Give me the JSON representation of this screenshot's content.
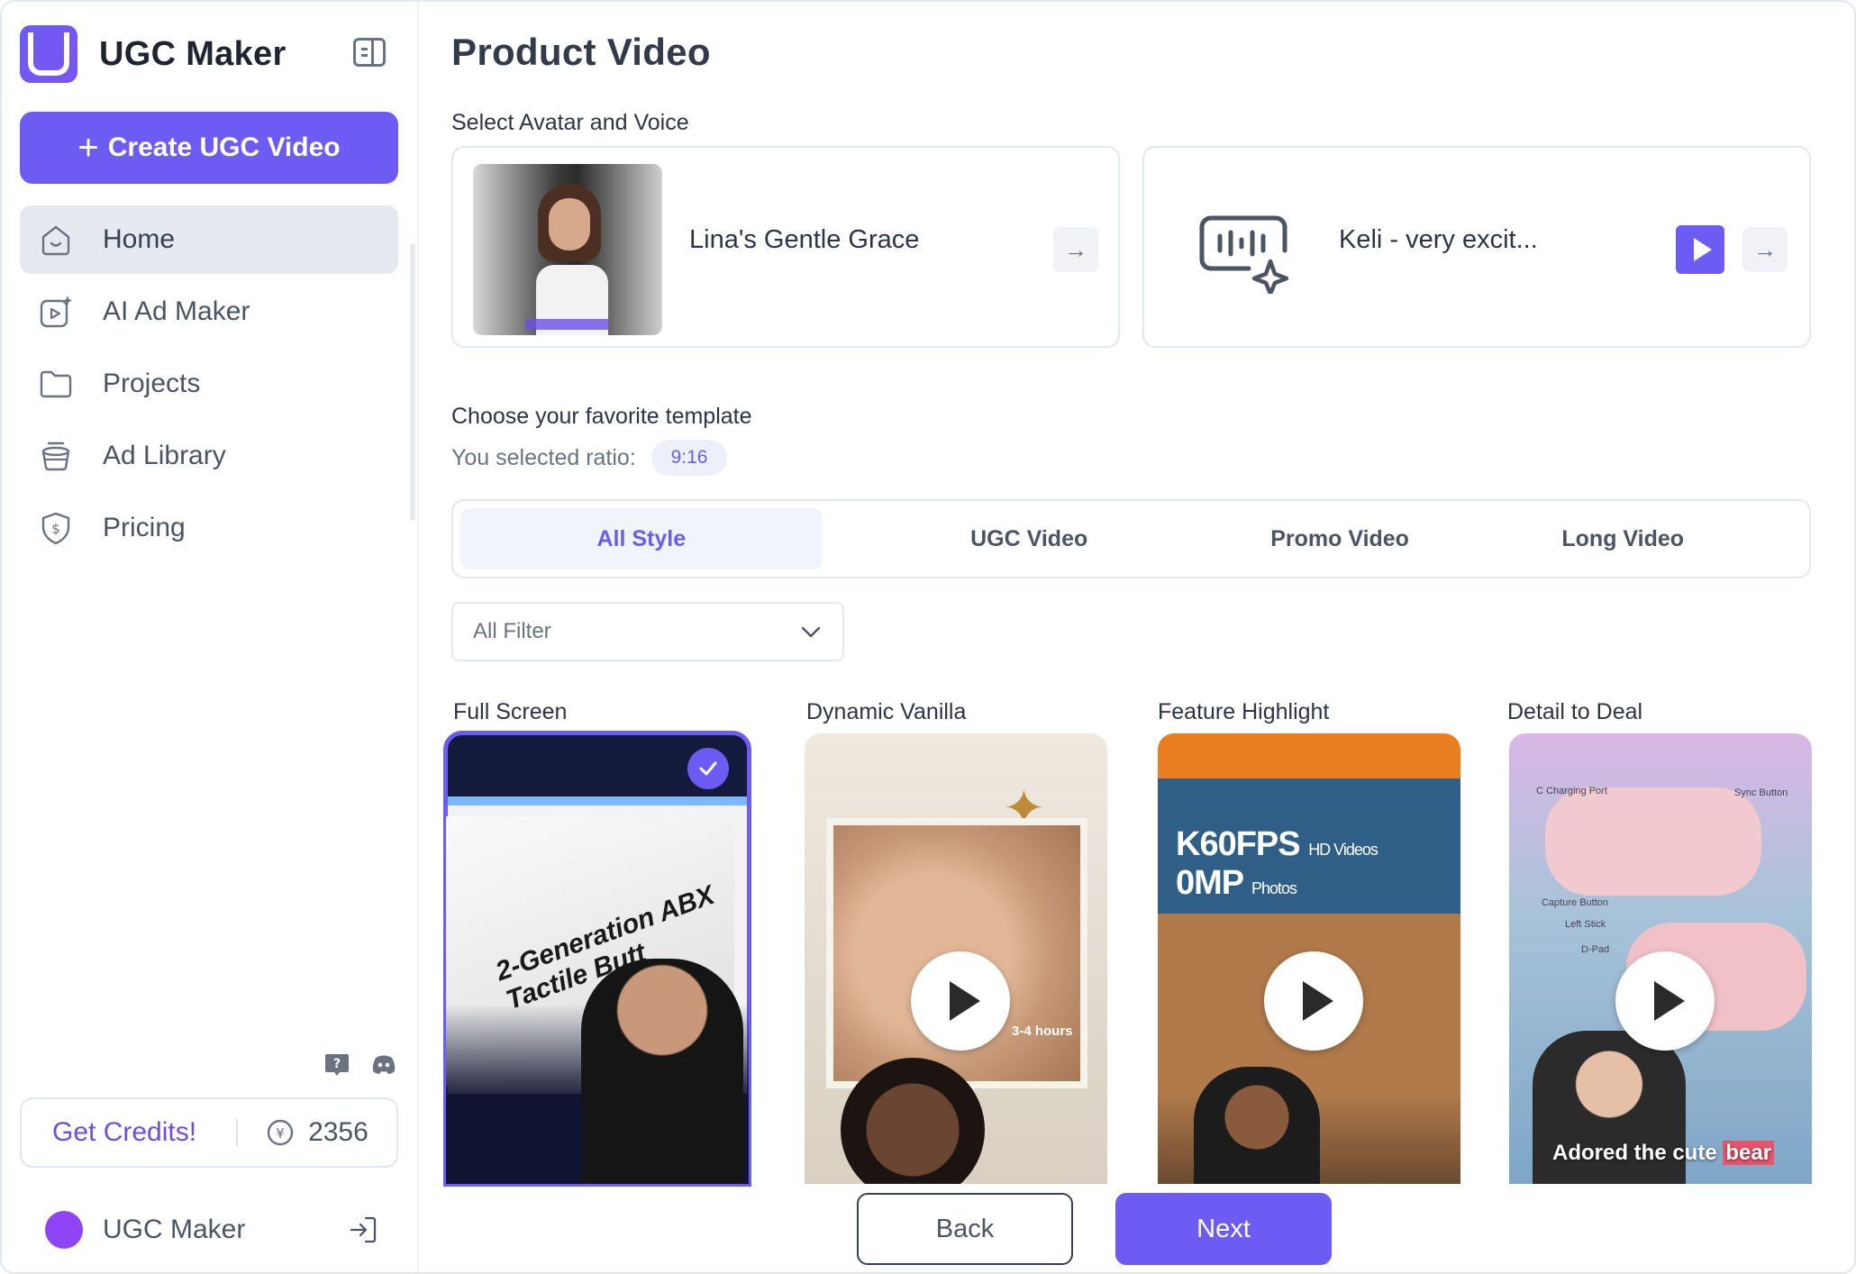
{
  "app": {
    "name": "UGC Maker",
    "create_label": "Create UGC Video"
  },
  "sidebar": {
    "items": [
      {
        "label": "Home",
        "icon": "home-icon",
        "active": true
      },
      {
        "label": "AI Ad Maker",
        "icon": "ai-video-icon",
        "active": false
      },
      {
        "label": "Projects",
        "icon": "folder-icon",
        "active": false
      },
      {
        "label": "Ad Library",
        "icon": "library-icon",
        "active": false
      },
      {
        "label": "Pricing",
        "icon": "pricing-shield-icon",
        "active": false
      }
    ],
    "credits": {
      "label": "Get Credits!",
      "value": "2356"
    },
    "user": {
      "name": "UGC Maker"
    }
  },
  "main": {
    "title": "Product Video",
    "avatar_section_label": "Select Avatar and Voice",
    "avatar_card": {
      "name": "Lina's Gentle Grace"
    },
    "voice_card": {
      "name": "Keli - very excit..."
    },
    "template_section_label": "Choose your favorite template",
    "ratio_label": "You selected ratio:",
    "ratio_value": "9:16",
    "tabs": [
      {
        "label": "All Style",
        "active": true
      },
      {
        "label": "UGC Video",
        "active": false
      },
      {
        "label": "Promo Video",
        "active": false
      },
      {
        "label": "Long Video",
        "active": false
      }
    ],
    "filter": {
      "value": "All Filter"
    },
    "templates": [
      {
        "name": "Full Screen",
        "selected": true,
        "overlay_text": "2-Generation ABX Tactile Butt"
      },
      {
        "name": "Dynamic Vanilla",
        "selected": false,
        "overlay_text": "3-4 hours"
      },
      {
        "name": "Feature Highlight",
        "selected": false,
        "overlay_text": "K60FPS",
        "overlay_small": "HD Videos",
        "overlay_text2": "0MP",
        "overlay_small2": "Photos"
      },
      {
        "name": "Detail to Deal",
        "selected": false,
        "overlay_text": "Adored the cute",
        "overlay_highlight": "bear",
        "micro_labels": [
          "C Charging Port",
          "Sync Button",
          "Capture Button",
          "Left Stick",
          "D-Pad"
        ]
      }
    ],
    "footer": {
      "back_label": "Back",
      "next_label": "Next"
    }
  },
  "colors": {
    "accent": "#6c5cf3",
    "active_nav_bg": "#e6e9ef"
  }
}
